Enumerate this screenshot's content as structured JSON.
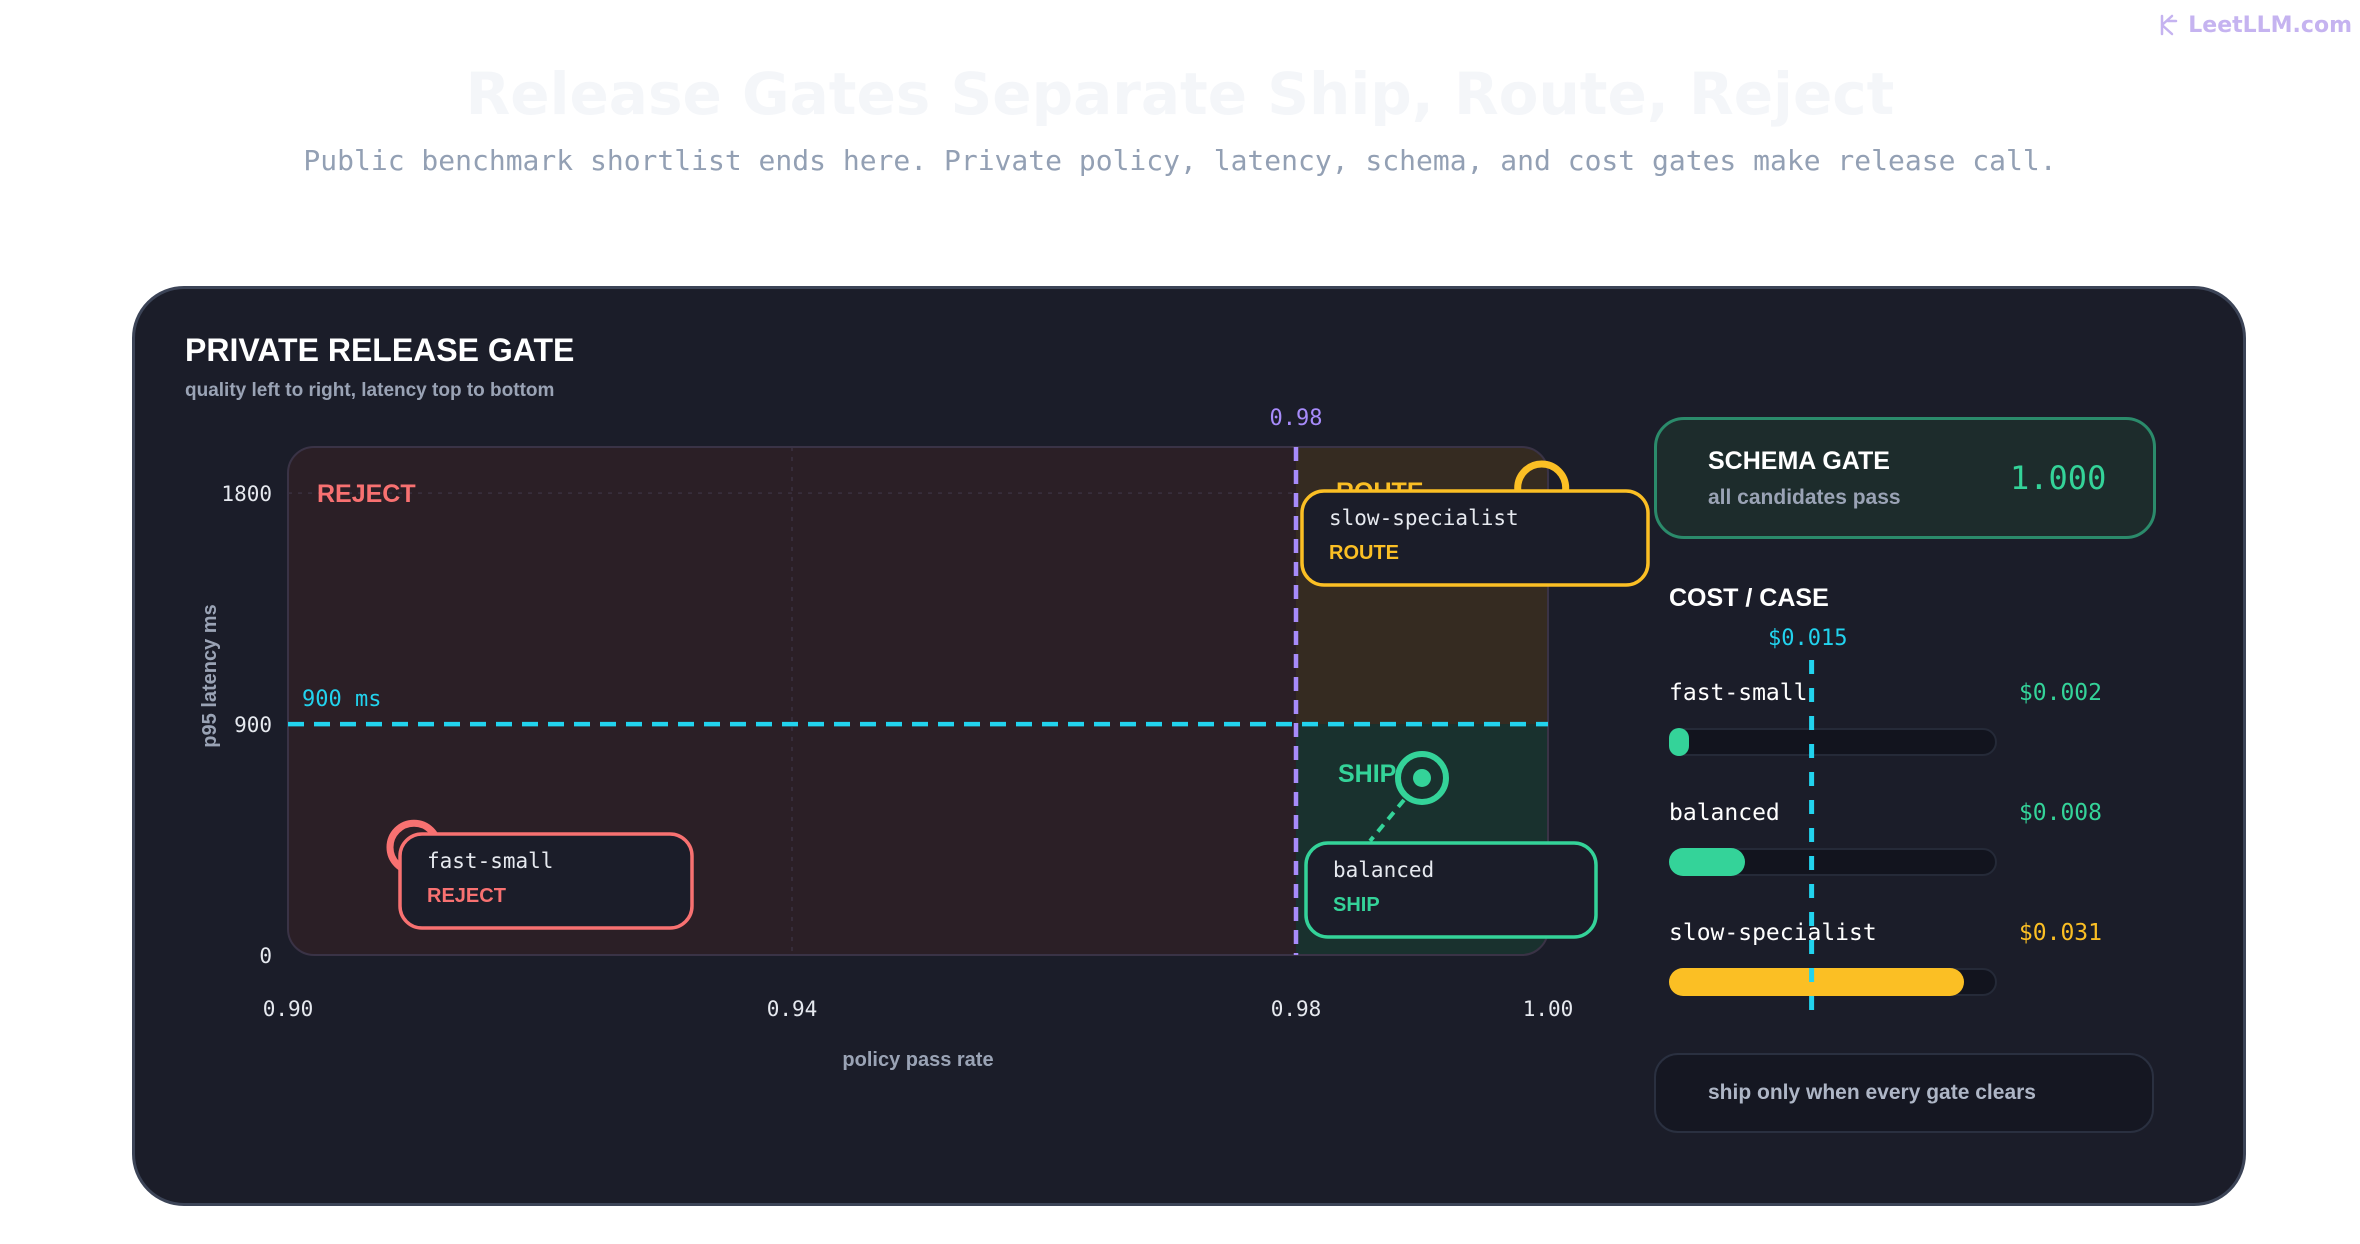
{
  "brand": {
    "text": "LeetLLM.com",
    "icon": "leetllm-logo-icon"
  },
  "header": {
    "title": "Release Gates Separate Ship, Route, Reject",
    "subtitle": "Public benchmark shortlist ends here. Private policy, latency, schema, and cost gates make release call."
  },
  "card": {
    "title": "PRIVATE RELEASE GATE",
    "subtitle": "quality left to right, latency top to bottom"
  },
  "chart_data": {
    "type": "scatter",
    "title": "PRIVATE RELEASE GATE",
    "subtitle": "quality left to right, latency top to bottom",
    "xlabel": "policy pass rate",
    "ylabel": "p95 latency ms",
    "xlim": [
      0.9,
      1.0
    ],
    "ylim": [
      0,
      1980
    ],
    "y_inverted": false,
    "grid": true,
    "x_ticks": [
      "0.90",
      "0.94",
      "0.98",
      "1.00"
    ],
    "y_ticks": [
      "0",
      "900",
      "1800"
    ],
    "thresholds": {
      "policy": {
        "value": 0.98,
        "label": "0.98"
      },
      "latency": {
        "value": 900,
        "label": "900 ms"
      }
    },
    "zones": [
      {
        "name": "REJECT",
        "color": "#f87171"
      },
      {
        "name": "ROUTE",
        "color": "#fbbf24"
      },
      {
        "name": "SHIP",
        "color": "#34d399"
      }
    ],
    "points": [
      {
        "name": "fast-small",
        "x": 0.91,
        "y": 420,
        "verdict": "REJECT",
        "color": "#f87171"
      },
      {
        "name": "slow-specialist",
        "x": 0.9995,
        "y": 1820,
        "verdict": "ROUTE",
        "color": "#fbbf24"
      },
      {
        "name": "balanced",
        "x": 0.99,
        "y": 690,
        "verdict": "SHIP",
        "color": "#34d399"
      }
    ]
  },
  "schema_gate": {
    "title": "SCHEMA GATE",
    "subtitle": "all candidates pass",
    "value": "1.000"
  },
  "cost": {
    "title": "COST / CASE",
    "threshold_label": "$0.015",
    "threshold_value": 0.015,
    "max_value": 0.0345,
    "rows": [
      {
        "name": "fast-small",
        "value_label": "$0.002",
        "value": 0.002,
        "color": "#34d399"
      },
      {
        "name": "balanced",
        "value_label": "$0.008",
        "value": 0.008,
        "color": "#34d399"
      },
      {
        "name": "slow-specialist",
        "value_label": "$0.031",
        "value": 0.031,
        "color": "#fbbf24"
      }
    ]
  },
  "footer": {
    "text": "ship only when every gate clears"
  }
}
